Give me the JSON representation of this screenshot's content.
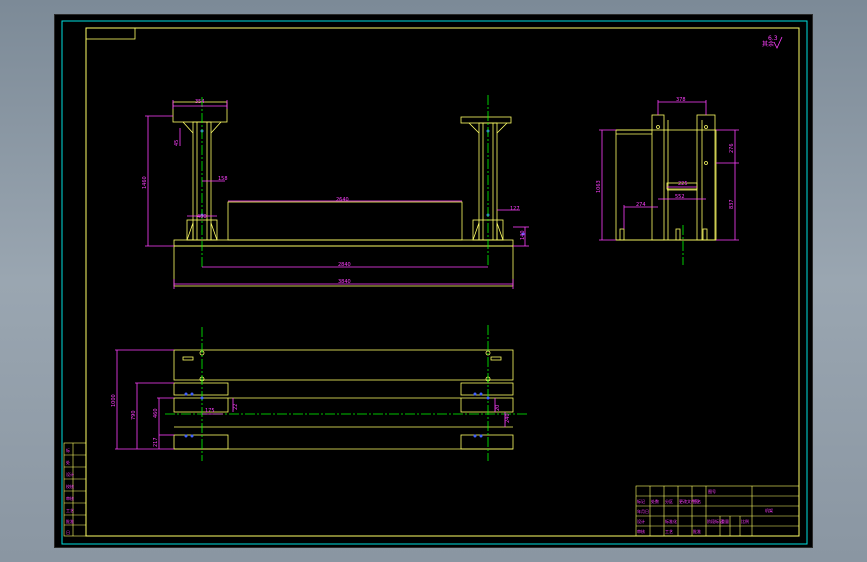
{
  "drawing": {
    "colors": {
      "background": "#000000",
      "frame": "#ffff66",
      "border": "#00e0e0",
      "dimension": "#ff3fff",
      "centerline": "#00ff00",
      "hidden": "#4060ff"
    },
    "roughness": {
      "value": "6.3",
      "prefix": "其余"
    },
    "front_view": {
      "dims": {
        "top_plate_width": "354",
        "plate_height": "45",
        "total_height": "1460",
        "column_width": "158",
        "base_width": "400",
        "span_inner": "2640",
        "span_center": "2840",
        "span_total": "3840",
        "gusset": "127",
        "base_thickness": "140"
      }
    },
    "side_view": {
      "dims": {
        "top_width": "378",
        "upper_height": "276",
        "bracket": "225",
        "inner_width": "552",
        "offset": "274",
        "lower_height": "837",
        "overall_height": "1063"
      }
    },
    "top_view": {
      "dims": {
        "overall": "1000",
        "mid": "790",
        "inner": "460",
        "foot": "217",
        "small_a": "175",
        "small_b": "22",
        "small_c": "20",
        "small_d": "240"
      }
    },
    "left_table": {
      "rows": [
        "标",
        "处",
        "设计",
        "校核",
        "审核",
        "工艺",
        "批准",
        "日"
      ]
    },
    "title_block": {
      "name": "机架",
      "header": "图号",
      "cells": [
        "标记",
        "处数",
        "分区",
        "更改文件号",
        "签名",
        "年月日",
        "设计",
        "标准化",
        "审核",
        "工艺",
        "批准",
        "阶段标记",
        "重量",
        "比例"
      ]
    }
  }
}
